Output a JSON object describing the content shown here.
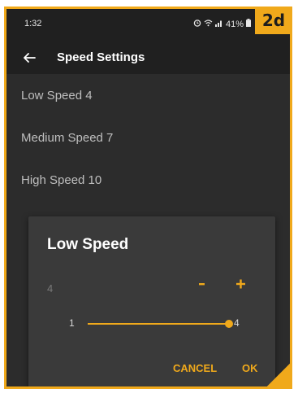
{
  "badge": "2d",
  "status_bar": {
    "time": "1:32",
    "battery": "41%"
  },
  "app_bar": {
    "title": "Speed Settings"
  },
  "list": [
    {
      "label": "Low Speed 4"
    },
    {
      "label": "Medium Speed 7"
    },
    {
      "label": "High Speed 10"
    }
  ],
  "dialog": {
    "title": "Low Speed",
    "current_value": "4",
    "minus_label": "-",
    "plus_label": "+",
    "slider": {
      "min": "1",
      "max": "4",
      "value": 4
    },
    "cancel_label": "CANCEL",
    "ok_label": "OK"
  },
  "colors": {
    "accent": "#f0a91b",
    "background": "#2c2c2c",
    "dialog": "#3a3a3a"
  }
}
